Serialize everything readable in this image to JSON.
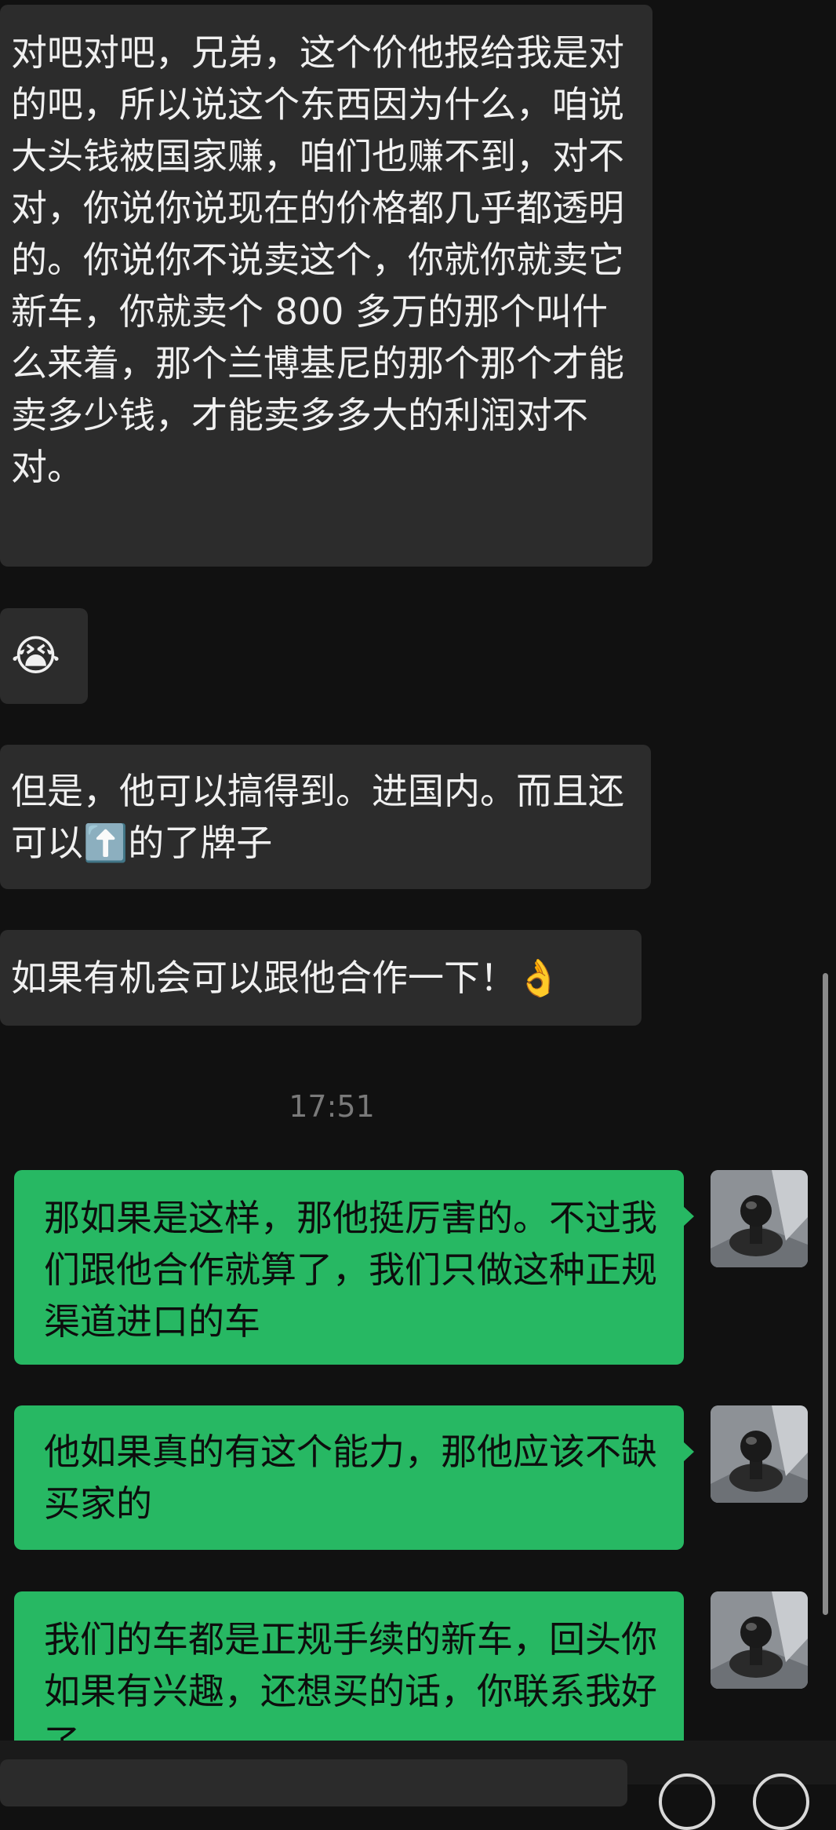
{
  "messages": [
    {
      "sender": "contact",
      "kind": "text",
      "text": "对吧对吧，兄弟，这个价他报给我是对的吧，所以说这个东西因为什么，咱说大头钱被国家赚，咱们也赚不到，对不对，你说你说现在的价格都几乎都透明的。你说你不说卖这个，你就你就卖它新车，你就卖个 800 多万的那个叫什么来着，那个兰博基尼的那个那个才能卖多少钱，才能卖多多大的利润对不对。"
    },
    {
      "sender": "contact",
      "kind": "emoji",
      "text": "😭"
    },
    {
      "sender": "contact",
      "kind": "text",
      "text": "但是，他可以搞得到。进国内。而且还可以⬆️的了牌子"
    },
    {
      "sender": "contact",
      "kind": "text",
      "text": "如果有机会可以跟他合作一下！👌"
    },
    {
      "sender": "me",
      "kind": "text",
      "text": "那如果是这样，那他挺厉害的。不过我们跟他合作就算了，我们只做这种正规渠道进口的车"
    },
    {
      "sender": "me",
      "kind": "text",
      "text": "他如果真的有这个能力，那他应该不缺买家的"
    },
    {
      "sender": "me",
      "kind": "text",
      "text": "我们的车都是正规手续的新车，回头你如果有兴趣，还想买的话，你联系我好了"
    }
  ],
  "timestamp": "17:51",
  "avatar": {
    "icon": "gear-shift-knob-photo"
  },
  "colors": {
    "background": "#111111",
    "incoming_bubble": "#2c2c2c",
    "outgoing_bubble": "#27b863"
  }
}
